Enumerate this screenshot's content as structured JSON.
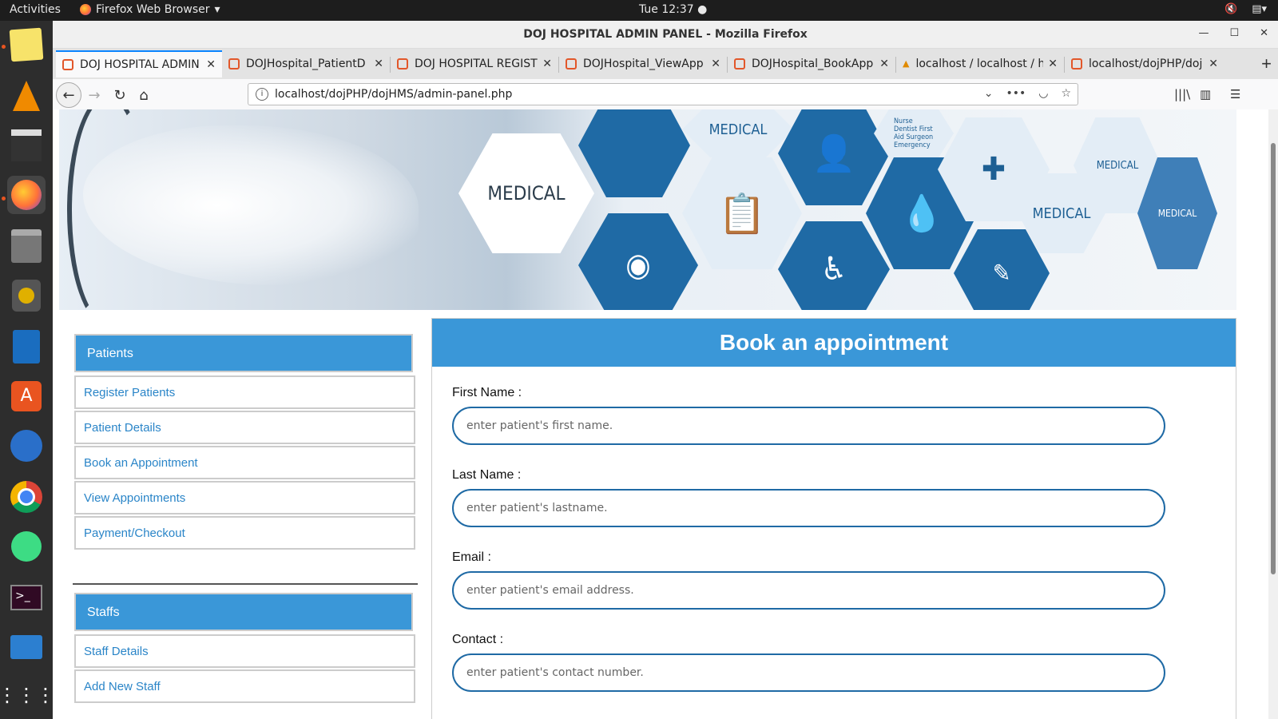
{
  "topbar": {
    "activities": "Activities",
    "app_name": "Firefox Web Browser",
    "clock": "Tue 12:37 ●"
  },
  "dock": {
    "icons": [
      "notes-icon",
      "vlc-icon",
      "video-editor-icon",
      "firefox-icon",
      "files-icon",
      "audio-icon",
      "writer-icon",
      "software-center-icon",
      "video-player-icon",
      "chrome-icon",
      "android-studio-icon",
      "terminal-icon",
      "monitor-icon",
      "app-grid-icon"
    ]
  },
  "window": {
    "title": "DOJ HOSPITAL ADMIN PANEL - Mozilla Firefox"
  },
  "tabs": [
    {
      "label": "DOJ HOSPITAL ADMIN",
      "active": true
    },
    {
      "label": "DOJHospital_PatientD"
    },
    {
      "label": "DOJ HOSPITAL REGISTE"
    },
    {
      "label": "DOJHospital_ViewApp"
    },
    {
      "label": "DOJHospital_BookApp"
    },
    {
      "label": "localhost / localhost / h"
    },
    {
      "label": "localhost/dojPHP/doj"
    }
  ],
  "urlbar": {
    "url": "localhost/dojPHP/dojHMS/admin-panel.php"
  },
  "banner": {
    "labels": [
      "MEDICAL",
      "MEDICAL",
      "MEDICAL",
      "MEDICAL",
      "MEDICAL",
      "Nurse Dentist First Aid Surgeon Emergency"
    ]
  },
  "sidebar": {
    "patients_header": "Patients",
    "patients_items": [
      "Register Patients",
      "Patient Details",
      "Book an Appointment",
      "View Appointments",
      "Payment/Checkout"
    ],
    "staff_header": "Staffs",
    "staff_items": [
      "Staff Details",
      "Add New Staff"
    ]
  },
  "form": {
    "title": "Book an appointment",
    "first_name_label": "First Name :",
    "first_name_placeholder": "enter patient's first name.",
    "last_name_label": "Last Name :",
    "last_name_placeholder": "enter patient's lastname.",
    "email_label": "Email :",
    "email_placeholder": "enter patient's email address.",
    "contact_label": "Contact :",
    "contact_placeholder": "enter patient's contact number."
  },
  "colors": {
    "accent": "#3a97d8",
    "input_border": "#1f6aa5",
    "link": "#2a85c8",
    "ubuntu_orange": "#e95420"
  }
}
